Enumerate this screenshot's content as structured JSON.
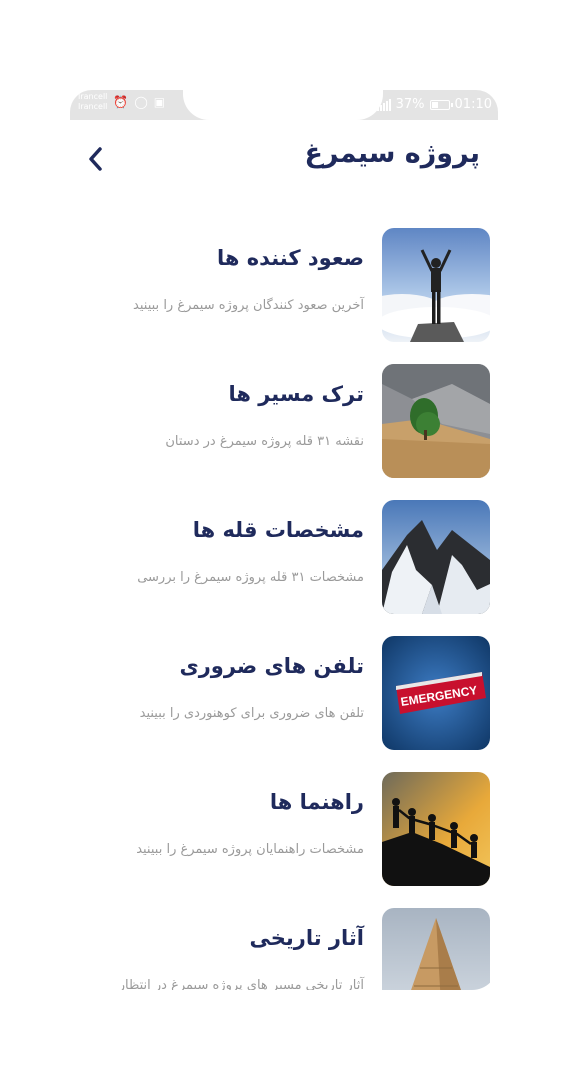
{
  "status_bar": {
    "carrier_1": "Irancell",
    "carrier_2": "Irancell",
    "battery_percent": "37%",
    "battery_level": 0.37,
    "time": "01:10"
  },
  "header": {
    "title": "پروژه سیمرغ",
    "back_icon": "chevron-left-icon"
  },
  "colors": {
    "title": "#1f2a5c",
    "subtitle": "#9a9a9a",
    "status_bar": "#e4e4e4"
  },
  "items": [
    {
      "title": "صعود کننده ها",
      "subtitle": "آخرین صعود کنندگان پروژه سیمرغ را ببینید",
      "image": "climber-summit-photo"
    },
    {
      "title": "ترک مسیر ها",
      "subtitle": "نقشه ۳۱ قله پروژه سیمرغ در دستان",
      "image": "mountain-path-tree-photo"
    },
    {
      "title": "مشخصات قله ها",
      "subtitle": "مشخصات ۳۱ قله پروژه سیمرغ را بررسی",
      "image": "snowy-peaks-photo"
    },
    {
      "title": "تلفن های ضروری",
      "subtitle": "تلفن های ضروری برای کوهنوردی را ببینید",
      "image": "emergency-sign-photo",
      "image_text": "EMERGENCY"
    },
    {
      "title": "راهنما ها",
      "subtitle": "مشخصات راهنمایان پروژه سیمرغ را ببینید",
      "image": "hikers-silhouette-photo"
    },
    {
      "title": "آثار تاریخی",
      "subtitle": "آثار تاریخی مسیر های پروژه سیمرغ در انتظار",
      "image": "historic-tower-photo"
    }
  ]
}
